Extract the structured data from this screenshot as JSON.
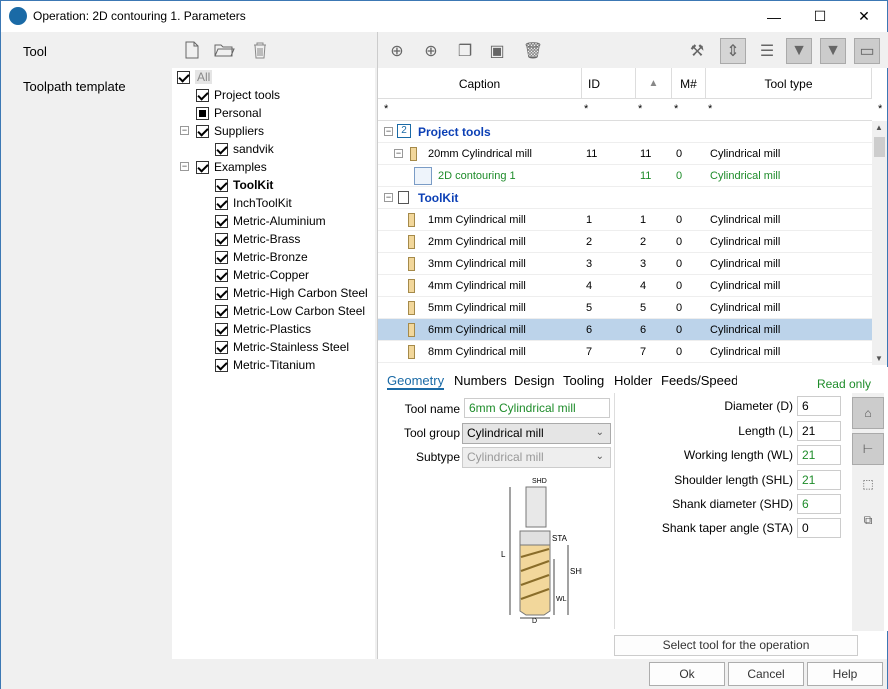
{
  "window": {
    "title": "Operation: 2D contouring 1. Parameters",
    "minimize": "—",
    "maximize": "☐",
    "close": "✕"
  },
  "leftnav": {
    "tool": "Tool",
    "template": "Toolpath template"
  },
  "tree": [
    {
      "label": "All",
      "state": "chk",
      "level": 0,
      "dim": true
    },
    {
      "label": "Project tools",
      "state": "chk",
      "level": 1
    },
    {
      "label": "Personal",
      "state": "part",
      "level": 1
    },
    {
      "label": "Suppliers",
      "state": "chk",
      "level": 1,
      "exp": "−"
    },
    {
      "label": "sandvik",
      "state": "chk",
      "level": 2
    },
    {
      "label": "Examples",
      "state": "chk",
      "level": 1,
      "exp": "−"
    },
    {
      "label": "ToolKit",
      "state": "chk",
      "level": 2,
      "bold": true
    },
    {
      "label": "InchToolKit",
      "state": "chk",
      "level": 2
    },
    {
      "label": "Metric-Aluminium",
      "state": "chk",
      "level": 2
    },
    {
      "label": "Metric-Brass",
      "state": "chk",
      "level": 2
    },
    {
      "label": "Metric-Bronze",
      "state": "chk",
      "level": 2
    },
    {
      "label": "Metric-Copper",
      "state": "chk",
      "level": 2
    },
    {
      "label": "Metric-High Carbon Steel",
      "state": "chk",
      "level": 2
    },
    {
      "label": "Metric-Low Carbon Steel",
      "state": "chk",
      "level": 2
    },
    {
      "label": "Metric-Plastics",
      "state": "chk",
      "level": 2
    },
    {
      "label": "Metric-Stainless Steel",
      "state": "chk",
      "level": 2
    },
    {
      "label": "Metric-Titanium",
      "state": "chk",
      "level": 2
    }
  ],
  "grid": {
    "headers": {
      "caption": "Caption",
      "id": "ID",
      "sort": "▲",
      "m": "M#",
      "type": "Tool type"
    },
    "filter": "*",
    "groups": {
      "project": "Project tools",
      "toolkit": "ToolKit"
    },
    "project_tool": {
      "caption": "20mm Cylindrical mill",
      "id": "11",
      "n": "11",
      "m": "0",
      "type": "Cylindrical mill"
    },
    "operation": {
      "caption": "2D contouring 1",
      "n": "11",
      "m": "0",
      "type": "Cylindrical mill"
    },
    "rows": [
      {
        "caption": "1mm Cylindrical mill",
        "id": "1",
        "n": "1",
        "m": "0",
        "type": "Cylindrical mill"
      },
      {
        "caption": "2mm Cylindrical mill",
        "id": "2",
        "n": "2",
        "m": "0",
        "type": "Cylindrical mill"
      },
      {
        "caption": "3mm Cylindrical mill",
        "id": "3",
        "n": "3",
        "m": "0",
        "type": "Cylindrical mill"
      },
      {
        "caption": "4mm Cylindrical mill",
        "id": "4",
        "n": "4",
        "m": "0",
        "type": "Cylindrical mill"
      },
      {
        "caption": "5mm Cylindrical mill",
        "id": "5",
        "n": "5",
        "m": "0",
        "type": "Cylindrical mill"
      },
      {
        "caption": "6mm Cylindrical mill",
        "id": "6",
        "n": "6",
        "m": "0",
        "type": "Cylindrical mill"
      },
      {
        "caption": "8mm Cylindrical mill",
        "id": "7",
        "n": "7",
        "m": "0",
        "type": "Cylindrical mill"
      }
    ]
  },
  "tabs": [
    "Geometry",
    "Numbers",
    "Design",
    "Tooling",
    "Holder",
    "Feeds/Speeds"
  ],
  "readonly": "Read only",
  "form": {
    "tool_name_label": "Tool name",
    "tool_name": "6mm Cylindrical mill",
    "tool_group_label": "Tool group",
    "tool_group": "Cylindrical mill",
    "subtype_label": "Subtype",
    "subtype": "Cylindrical mill",
    "diameter_label": "Diameter (D)",
    "diameter": "6",
    "length_label": "Length (L)",
    "length": "21",
    "wl_label": "Working length (WL)",
    "wl": "21",
    "shl_label": "Shoulder length (SHL)",
    "shl": "21",
    "shd_label": "Shank diameter (SHD)",
    "shd": "6",
    "sta_label": "Shank taper angle (STA)",
    "sta": "0"
  },
  "diagram": {
    "shd": "SHD",
    "sta": "STA",
    "l": "L",
    "shl": "SHL",
    "wl": "WL",
    "d": "D"
  },
  "select_btn": "Select tool for the operation",
  "footer": {
    "ok": "Ok",
    "cancel": "Cancel",
    "help": "Help"
  }
}
